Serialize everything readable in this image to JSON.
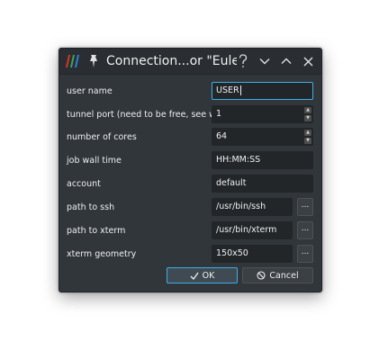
{
  "window": {
    "title": "Connection...or \"Euler\""
  },
  "titlebar": {
    "help_icon": "question-mark-icon",
    "minimize_icon": "chevron-down-icon",
    "maximize_icon": "chevron-up-icon",
    "close_icon": "close-icon"
  },
  "form": {
    "user_name": {
      "label": "user name",
      "value": "USER"
    },
    "tunnel_port": {
      "label": "tunnel port (need to be free, see wiki)",
      "value": "1"
    },
    "cores": {
      "label": "number of cores",
      "value": "64"
    },
    "wall_time": {
      "label": "job wall time",
      "value": "HH:MM:SS"
    },
    "account": {
      "label": "account",
      "value": "default"
    },
    "path_ssh": {
      "label": "path to ssh",
      "value": "/usr/bin/ssh",
      "browse": "..."
    },
    "path_xterm": {
      "label": "path to xterm",
      "value": "/usr/bin/xterm",
      "browse": "..."
    },
    "xterm_geometry": {
      "label": "xterm geometry",
      "value": "150x50",
      "browse": "..."
    }
  },
  "buttons": {
    "ok": "OK",
    "cancel": "Cancel"
  },
  "colors": {
    "window_bg": "#31363b",
    "field_bg": "#232629",
    "accent": "#3daee9",
    "text": "#eff0f1"
  }
}
